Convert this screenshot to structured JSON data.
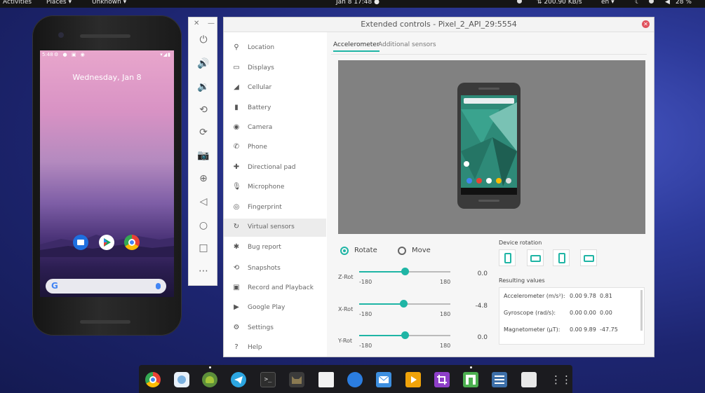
{
  "topbar": {
    "activities": "Activities",
    "places": "Places ▾",
    "app": "Unknown ▾",
    "clock": "Jan 8  17:48 ●",
    "network": "⇅ 200.90 KB/s",
    "lang": "en ▾",
    "battery": "28 %"
  },
  "phone": {
    "status_time": "5:48",
    "date": "Wednesday, Jan 8",
    "search_logo": "G"
  },
  "toolbar": {
    "close": "✕",
    "minimize": "—",
    "buttons": [
      {
        "name": "power-icon",
        "glyph": "⏻"
      },
      {
        "name": "volume-up-icon",
        "glyph": "🔊"
      },
      {
        "name": "volume-down-icon",
        "glyph": "🔉"
      },
      {
        "name": "rotate-left-icon",
        "glyph": "⟲"
      },
      {
        "name": "rotate-right-icon",
        "glyph": "⟳"
      },
      {
        "name": "camera-icon",
        "glyph": "📷"
      },
      {
        "name": "zoom-icon",
        "glyph": "⊕"
      },
      {
        "name": "back-icon",
        "glyph": "◁"
      },
      {
        "name": "home-icon",
        "glyph": "○"
      },
      {
        "name": "overview-icon",
        "glyph": "□"
      },
      {
        "name": "more-icon",
        "glyph": "⋯"
      }
    ]
  },
  "window": {
    "title": "Extended controls - Pixel_2_API_29:5554",
    "close_glyph": "✕"
  },
  "sidebar": {
    "items": [
      {
        "label": "Location",
        "icon": "location-pin-icon",
        "glyph": "⚲"
      },
      {
        "label": "Displays",
        "icon": "display-icon",
        "glyph": "▭"
      },
      {
        "label": "Cellular",
        "icon": "cellular-icon",
        "glyph": "◢"
      },
      {
        "label": "Battery",
        "icon": "battery-icon",
        "glyph": "▮"
      },
      {
        "label": "Camera",
        "icon": "camera-icon",
        "glyph": "◉"
      },
      {
        "label": "Phone",
        "icon": "phone-icon",
        "glyph": "✆"
      },
      {
        "label": "Directional pad",
        "icon": "dpad-icon",
        "glyph": "✚"
      },
      {
        "label": "Microphone",
        "icon": "microphone-icon",
        "glyph": "🎙"
      },
      {
        "label": "Fingerprint",
        "icon": "fingerprint-icon",
        "glyph": "◎"
      },
      {
        "label": "Virtual sensors",
        "icon": "virtual-sensors-icon",
        "glyph": "↻"
      },
      {
        "label": "Bug report",
        "icon": "bug-icon",
        "glyph": "✱"
      },
      {
        "label": "Snapshots",
        "icon": "snapshot-icon",
        "glyph": "⟲"
      },
      {
        "label": "Record and Playback",
        "icon": "record-icon",
        "glyph": "▣"
      },
      {
        "label": "Google Play",
        "icon": "google-play-icon",
        "glyph": "▶"
      },
      {
        "label": "Settings",
        "icon": "gear-icon",
        "glyph": "⚙"
      },
      {
        "label": "Help",
        "icon": "help-icon",
        "glyph": "?"
      }
    ]
  },
  "tabs": {
    "accelerometer": "Accelerometer",
    "additional": "Additional sensors"
  },
  "mode": {
    "rotate": "Rotate",
    "move": "Move"
  },
  "sliders": [
    {
      "label": "Z-Rot",
      "min": "-180",
      "max": "180",
      "value": "0.0",
      "position": 0.5
    },
    {
      "label": "X-Rot",
      "min": "-180",
      "max": "180",
      "value": "-4.8",
      "position": 0.487
    },
    {
      "label": "Y-Rot",
      "min": "-180",
      "max": "180",
      "value": "0.0",
      "position": 0.5
    }
  ],
  "rotation": {
    "title": "Device rotation"
  },
  "results": {
    "title": "Resulting values",
    "rows": [
      {
        "label": "Accelerometer (m/s²):",
        "a": "0.00",
        "b": "9.78",
        "c": "0.81"
      },
      {
        "label": "Gyroscope (rad/s):",
        "a": "0.00",
        "b": "0.00",
        "c": "0.00"
      },
      {
        "label": "Magnetometer (µT):",
        "a": "0.00",
        "b": "9.89",
        "c": "-47.75"
      }
    ]
  },
  "colors": {
    "accent": "#1fb5a5",
    "close": "#e0525e"
  }
}
